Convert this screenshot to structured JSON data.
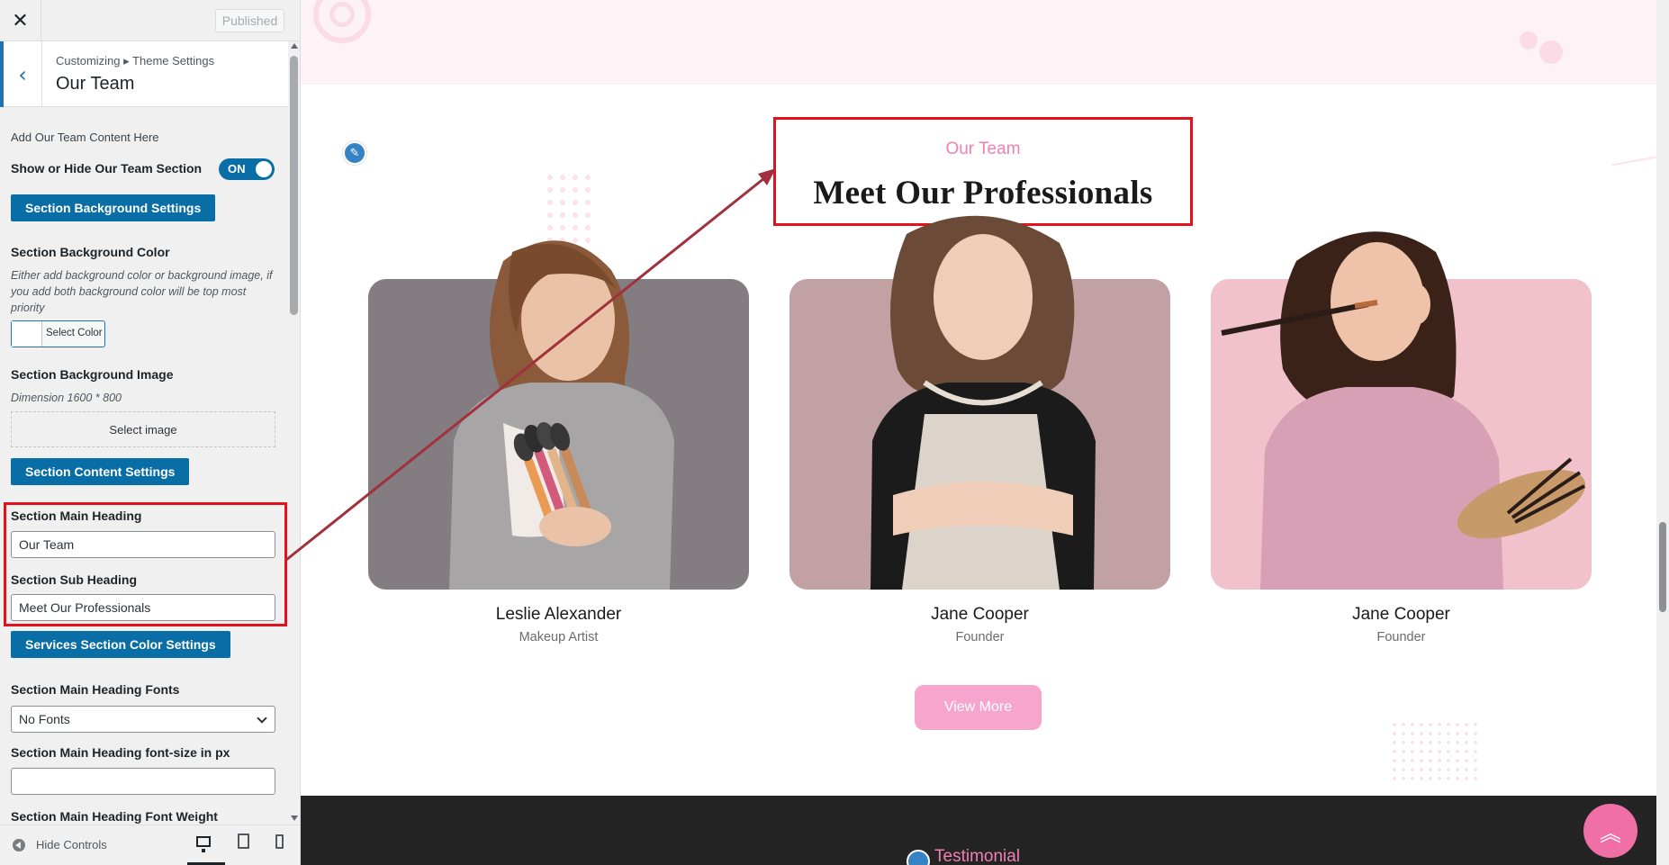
{
  "topbar": {
    "close_icon": "close-icon",
    "published_label": "Published"
  },
  "header": {
    "breadcrumb": "Customizing ▸ Theme Settings",
    "title": "Our Team"
  },
  "panel": {
    "intro": "Add Our Team Content Here",
    "show_hide_label": "Show or Hide Our Team Section",
    "toggle_state": "ON",
    "bg_settings_btn": "Section Background Settings",
    "bg_color_label": "Section Background Color",
    "bg_color_desc": "Either add background color or background image, if you add both background color will be top most priority",
    "select_color_label": "Select Color",
    "bg_image_label": "Section Background Image",
    "bg_image_dimension": "Dimension 1600 * 800",
    "select_image_label": "Select image",
    "content_settings_btn": "Section Content Settings",
    "main_heading_label": "Section Main Heading",
    "main_heading_value": "Our Team",
    "sub_heading_label": "Section Sub Heading",
    "sub_heading_value": "Meet Our Professionals",
    "color_settings_btn": "Services Section Color Settings",
    "heading_fonts_label": "Section Main Heading Fonts",
    "heading_fonts_value": "No Fonts",
    "font_size_label": "Section Main Heading font-size in px",
    "font_size_value": "",
    "font_weight_label": "Section Main Heading Font Weight"
  },
  "footer": {
    "hide_controls_label": "Hide Controls",
    "devices": [
      "desktop",
      "tablet",
      "mobile"
    ]
  },
  "preview": {
    "section_sub": "Our Team",
    "section_title": "Meet Our Professionals",
    "members": [
      {
        "name": "Leslie Alexander",
        "role": "Makeup Artist",
        "bg": "#837c80"
      },
      {
        "name": "Jane Cooper",
        "role": "Founder",
        "bg": "#c2a1a4"
      },
      {
        "name": "Jane Cooper",
        "role": "Founder",
        "bg": "#f2c2cc"
      }
    ],
    "view_more_label": "View More",
    "next_section_title": "Testimonial"
  },
  "colors": {
    "accent_blue": "#0a6ea6",
    "pink": "#f07fb2",
    "highlight_red": "#e2111c",
    "arrow": "#a0313d"
  }
}
